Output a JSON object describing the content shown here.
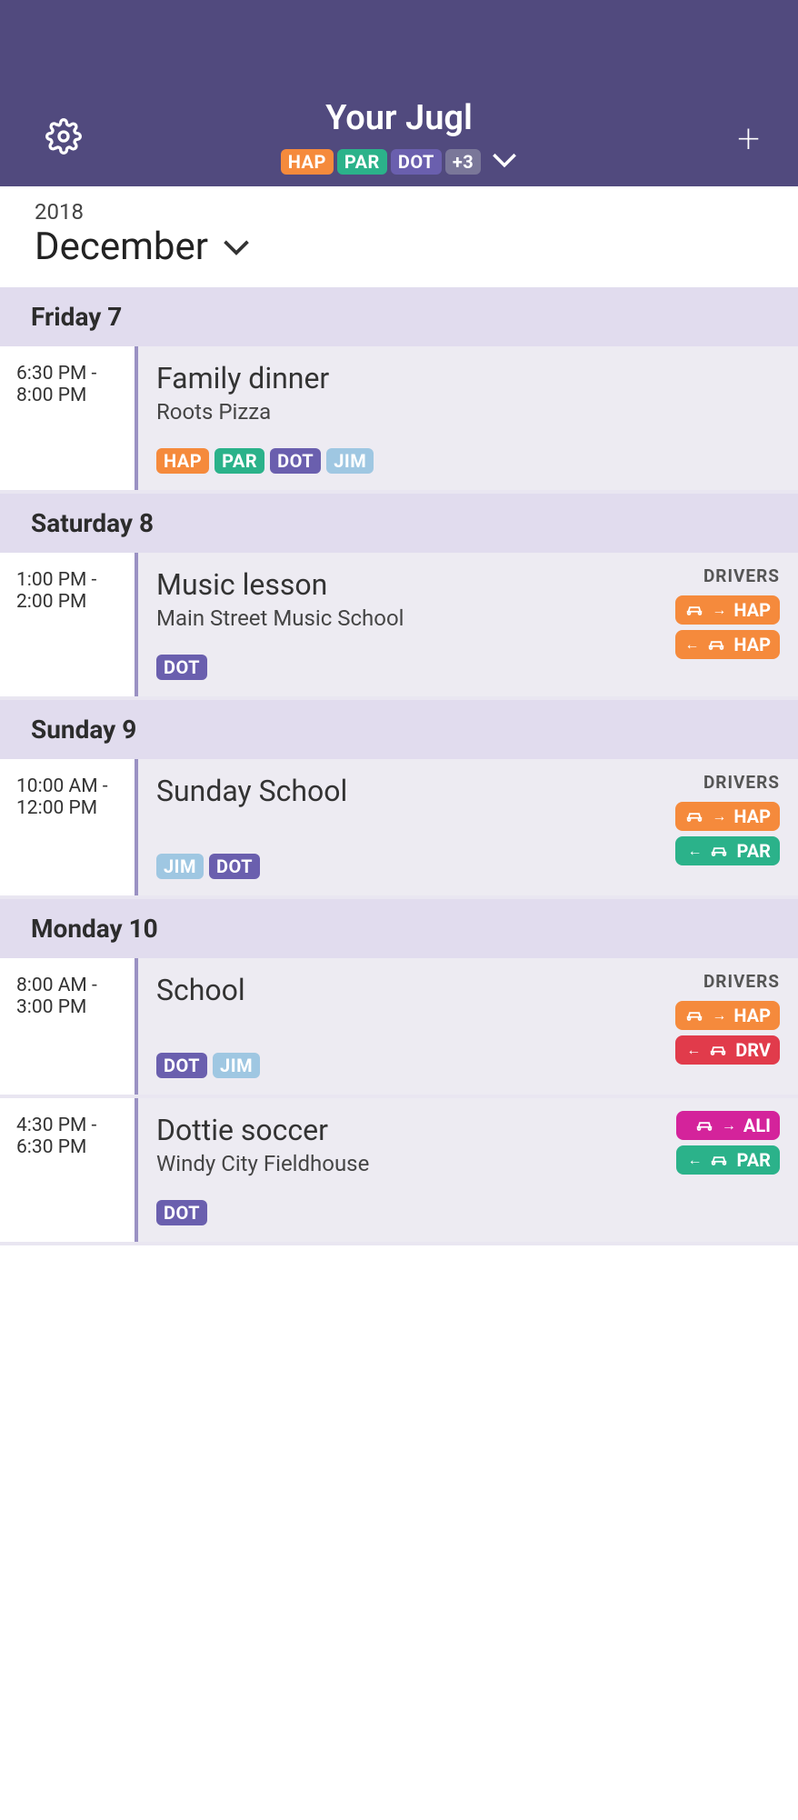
{
  "header": {
    "title": "Your Jugl",
    "tags": [
      {
        "label": "HAP",
        "color": "orange"
      },
      {
        "label": "PAR",
        "color": "green"
      },
      {
        "label": "DOT",
        "color": "purple"
      }
    ],
    "more_tag": "+3"
  },
  "month_bar": {
    "year": "2018",
    "month": "December"
  },
  "days": [
    {
      "header": "Friday 7",
      "events": [
        {
          "time": "6:30 PM - 8:00 PM",
          "title": "Family dinner",
          "location": "Roots Pizza",
          "tags": [
            {
              "label": "HAP",
              "color": "orange"
            },
            {
              "label": "PAR",
              "color": "green"
            },
            {
              "label": "DOT",
              "color": "purple"
            },
            {
              "label": "JIM",
              "color": "ltblue"
            }
          ],
          "drivers_label": "",
          "drivers": []
        }
      ]
    },
    {
      "header": "Saturday 8",
      "events": [
        {
          "time": "1:00 PM - 2:00 PM",
          "title": "Music lesson",
          "location": "Main Street Music School",
          "tags": [
            {
              "label": "DOT",
              "color": "purple"
            }
          ],
          "drivers_label": "DRIVERS",
          "drivers": [
            {
              "dir": "to",
              "label": "HAP",
              "color": "orange"
            },
            {
              "dir": "from",
              "label": "HAP",
              "color": "orange"
            }
          ]
        }
      ]
    },
    {
      "header": "Sunday 9",
      "events": [
        {
          "time": "10:00 AM - 12:00 PM",
          "title": "Sunday School",
          "location": "",
          "tags": [
            {
              "label": "JIM",
              "color": "ltblue"
            },
            {
              "label": "DOT",
              "color": "purple"
            }
          ],
          "drivers_label": "DRIVERS",
          "drivers": [
            {
              "dir": "to",
              "label": "HAP",
              "color": "orange"
            },
            {
              "dir": "from",
              "label": "PAR",
              "color": "green"
            }
          ]
        }
      ]
    },
    {
      "header": "Monday 10",
      "events": [
        {
          "time": "8:00 AM - 3:00 PM",
          "title": "School",
          "location": "",
          "tags": [
            {
              "label": "DOT",
              "color": "purple"
            },
            {
              "label": "JIM",
              "color": "ltblue"
            }
          ],
          "drivers_label": "DRIVERS",
          "drivers": [
            {
              "dir": "to",
              "label": "HAP",
              "color": "orange"
            },
            {
              "dir": "from",
              "label": "DRV",
              "color": "red"
            }
          ]
        },
        {
          "time": "4:30 PM - 6:30 PM",
          "title": "Dottie soccer",
          "location": "Windy City Fieldhouse",
          "tags": [
            {
              "label": "DOT",
              "color": "purple"
            }
          ],
          "drivers_label": "",
          "drivers": [
            {
              "dir": "to",
              "label": "ALI",
              "color": "pink"
            },
            {
              "dir": "from",
              "label": "PAR",
              "color": "green"
            }
          ]
        }
      ]
    }
  ]
}
